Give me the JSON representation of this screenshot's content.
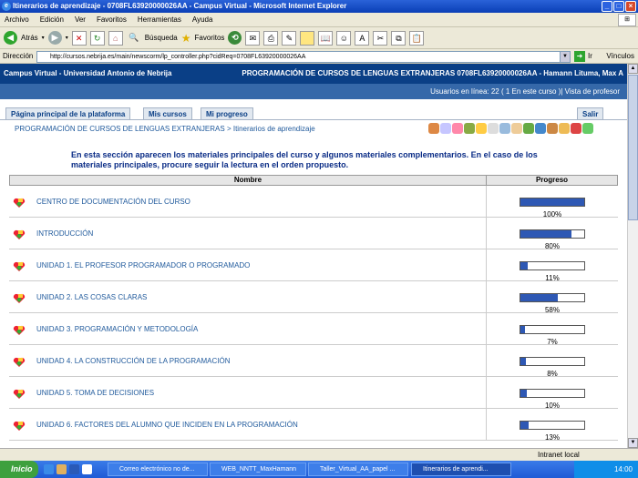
{
  "window": {
    "title": "Itinerarios de aprendizaje - 0708FL63920000026AA - Campus Virtual - Microsoft Internet Explorer"
  },
  "menu": [
    "Archivo",
    "Edición",
    "Ver",
    "Favoritos",
    "Herramientas",
    "Ayuda"
  ],
  "toolbar": {
    "back": "Atrás",
    "search": "Búsqueda",
    "favorites": "Favoritos"
  },
  "address": {
    "label": "Dirección",
    "url": "http://cursos.nebrija.es/main/newscorm/lp_controller.php?cidReq=0708FL63920000026AA",
    "go": "Ir",
    "links": "Vínculos"
  },
  "header": {
    "site": "Campus Virtual - Universidad Antonio de Nebrija",
    "course": "PROGRAMACIÓN DE CURSOS DE LENGUAS EXTRANJERAS 0708FL63920000026AA - Hamann Lituma, Max A"
  },
  "online": {
    "label": "Usuarios en línea:",
    "count": "22",
    "rest": "( 1 En este curso )| Vista de profesor"
  },
  "tabs": {
    "home": "Página principal de la plataforma",
    "courses": "Mis cursos",
    "progress": "Mi progreso",
    "logout": "Salir"
  },
  "breadcrumb": {
    "course": "PROGRAMACIÓN DE CURSOS DE LENGUAS EXTRANJERAS",
    "sep": " > ",
    "current": "Itinerarios de aprendizaje"
  },
  "intro": "En esta sección aparecen los materiales principales del curso y algunos materiales complementarios. En el caso de los materiales principales, procure seguir la lectura en el orden propuesto.",
  "table": {
    "headers": {
      "name": "Nombre",
      "progress": "Progreso"
    },
    "rows": [
      {
        "name": "CENTRO DE DOCUMENTACIÓN DEL CURSO",
        "progress": 100,
        "label": "100%"
      },
      {
        "name": "INTRODUCCIÓN",
        "progress": 80,
        "label": "80%"
      },
      {
        "name": "UNIDAD 1. EL PROFESOR PROGRAMADOR O PROGRAMADO",
        "progress": 11,
        "label": "11%"
      },
      {
        "name": "UNIDAD 2. LAS COSAS CLARAS",
        "progress": 58,
        "label": "58%"
      },
      {
        "name": "UNIDAD 3. PROGRAMACIÓN Y METODOLOGÍA",
        "progress": 7,
        "label": "7%"
      },
      {
        "name": "UNIDAD 4. LA CONSTRUCCIÓN DE LA PROGRAMACIÓN",
        "progress": 8,
        "label": "8%"
      },
      {
        "name": "UNIDAD 5. TOMA DE DECISIONES",
        "progress": 10,
        "label": "10%"
      },
      {
        "name": "UNIDAD 6. FACTORES DEL ALUMNO QUE INCIDEN EN LA PROGRAMACIÓN",
        "progress": 13,
        "label": "13%"
      }
    ]
  },
  "status": {
    "zone": "Intranet local"
  },
  "taskbar": {
    "start": "Inicio",
    "tasks": [
      "Correo electrónico no de...",
      "WEB_NNTT_MaxHamann",
      "Taller_Virtual_AA_papel ...",
      "Itinerarios de aprendi..."
    ],
    "time": "14:00"
  },
  "colors": {
    "header": "#0a3f86",
    "bar": "#2e58b4",
    "link": "#205a9c"
  }
}
